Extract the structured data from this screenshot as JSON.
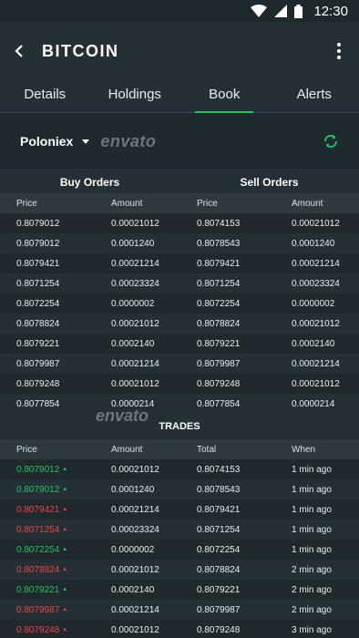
{
  "status_bar": {
    "time": "12:30"
  },
  "header": {
    "title": "BITCOIN"
  },
  "tabs": [
    {
      "label": "Details",
      "active": false
    },
    {
      "label": "Holdings",
      "active": false
    },
    {
      "label": "Book",
      "active": true
    },
    {
      "label": "Alerts",
      "active": false
    }
  ],
  "exchange": {
    "selected": "Poloniex",
    "watermark": "envato"
  },
  "orders": {
    "buy_title": "Buy  Orders",
    "sell_title": "Sell Orders",
    "columns": [
      "Price",
      "Amount",
      "Price",
      "Amount"
    ],
    "rows": [
      [
        "0.8079012",
        "0.00021012",
        "0.8074153",
        "0.00021012"
      ],
      [
        "0.8079012",
        "0.0001240",
        "0.8078543",
        "0.0001240"
      ],
      [
        "0.8079421",
        "0.00021214",
        "0.8079421",
        "0.00021214"
      ],
      [
        "0.8071254",
        "0.00023324",
        "0.8071254",
        "0.00023324"
      ],
      [
        "0.8072254",
        "0.0000002",
        "0.8072254",
        "0.0000002"
      ],
      [
        "0.8078824",
        "0.00021012",
        "0.8078824",
        "0.00021012"
      ],
      [
        "0.8079221",
        "0.0002140",
        "0.8079221",
        "0.0002140"
      ],
      [
        "0.8079987",
        "0.00021214",
        "0.8079987",
        "0.00021214"
      ],
      [
        "0.8079248",
        "0.00021012",
        "0.8079248",
        "0.00021012"
      ],
      [
        "0.8077854",
        "0.0000214",
        "0.8077854",
        "0.0000214"
      ]
    ]
  },
  "trades": {
    "title": "TRADES",
    "watermark": "envato",
    "columns": [
      "Price",
      "Amount",
      "Total",
      "When"
    ],
    "rows": [
      {
        "price": "0.8079012",
        "dir": "up",
        "amount": "0.00021012",
        "total": "0.8074153",
        "when": "1 min ago"
      },
      {
        "price": "0.8079012",
        "dir": "up",
        "amount": "0.0001240",
        "total": "0.8078543",
        "when": "1 min ago"
      },
      {
        "price": "0.8079421",
        "dir": "down",
        "amount": "0.00021214",
        "total": "0.8079421",
        "when": "1 min ago"
      },
      {
        "price": "0.8071254",
        "dir": "down",
        "amount": "0.00023324",
        "total": "0.8071254",
        "when": "1 min ago"
      },
      {
        "price": "0.8072254",
        "dir": "up",
        "amount": "0.0000002",
        "total": "0.8072254",
        "when": "1 min ago"
      },
      {
        "price": "0.8078824",
        "dir": "down",
        "amount": "0.00021012",
        "total": "0.8078824",
        "when": "2 min ago"
      },
      {
        "price": "0.8079221",
        "dir": "up",
        "amount": "0.0002140",
        "total": "0.8079221",
        "when": "2 min ago"
      },
      {
        "price": "0.8079987",
        "dir": "down",
        "amount": "0.00021214",
        "total": "0.8079987",
        "when": "2 min ago"
      },
      {
        "price": "0.8079248",
        "dir": "down",
        "amount": "0.00021012",
        "total": "0.8079248",
        "when": "3 min ago"
      }
    ]
  },
  "colors": {
    "accent": "#22c55e",
    "up": "#22c55e",
    "down": "#ef4444",
    "background": "#243036"
  }
}
